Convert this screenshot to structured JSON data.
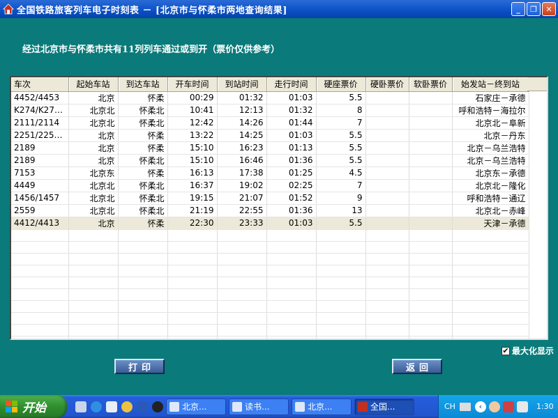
{
  "window": {
    "title": "全国铁路旅客列车电子时刻表 － [北京市与怀柔市两地查询结果]",
    "minimize": "_",
    "restore": "❐",
    "close": "✕"
  },
  "summary": "经过北京市与怀柔市共有11列列车通过或到开（票价仅供参考）",
  "table": {
    "headers": [
      "车次",
      "起始车站",
      "到达车站",
      "开车时间",
      "到站时间",
      "走行时间",
      "硬座票价",
      "硬卧票价",
      "软卧票价",
      "始发站－终到站"
    ],
    "rows": [
      [
        "4452/4453",
        "北京",
        "怀柔",
        "00:29",
        "01:32",
        "01:03",
        "5.5",
        "",
        "",
        "石家庄－承德"
      ],
      [
        "K274/K275...",
        "北京北",
        "怀柔北",
        "10:41",
        "12:13",
        "01:32",
        "8",
        "",
        "",
        "呼和浩特－海拉尔"
      ],
      [
        "2111/2114",
        "北京北",
        "怀柔北",
        "12:42",
        "14:26",
        "01:44",
        "7",
        "",
        "",
        "北京北－阜新"
      ],
      [
        "2251/2253/...",
        "北京",
        "怀柔",
        "13:22",
        "14:25",
        "01:03",
        "5.5",
        "",
        "",
        "北京－丹东"
      ],
      [
        "2189",
        "北京",
        "怀柔",
        "15:10",
        "16:23",
        "01:13",
        "5.5",
        "",
        "",
        "北京－乌兰浩特"
      ],
      [
        "2189",
        "北京",
        "怀柔北",
        "15:10",
        "16:46",
        "01:36",
        "5.5",
        "",
        "",
        "北京－乌兰浩特"
      ],
      [
        "7153",
        "北京东",
        "怀柔",
        "16:13",
        "17:38",
        "01:25",
        "4.5",
        "",
        "",
        "北京东－承德"
      ],
      [
        "4449",
        "北京北",
        "怀柔北",
        "16:37",
        "19:02",
        "02:25",
        "7",
        "",
        "",
        "北京北－隆化"
      ],
      [
        "1456/1457",
        "北京北",
        "怀柔北",
        "19:15",
        "21:07",
        "01:52",
        "9",
        "",
        "",
        "呼和浩特－通辽"
      ],
      [
        "2559",
        "北京北",
        "怀柔北",
        "21:19",
        "22:55",
        "01:36",
        "13",
        "",
        "",
        "北京北－赤峰"
      ],
      [
        "4412/4413",
        "北京",
        "怀柔",
        "22:30",
        "23:33",
        "01:03",
        "5.5",
        "",
        "",
        "天津－承德"
      ]
    ],
    "selected_row": 10,
    "empty_rows": 10
  },
  "max_display": {
    "label": "最大化显示",
    "checked": true
  },
  "buttons": {
    "print": "打印",
    "back": "返回"
  },
  "taskbar": {
    "start": "开始",
    "tasks": [
      "北京...",
      "读书...",
      "北京...",
      "全国..."
    ],
    "active_task": 3,
    "lang": "CH",
    "clock": "1:30"
  },
  "colors": {
    "client_bg": "#0a7a7a",
    "title_bar": "#0a4fc6",
    "selected_row": "#ede9d9",
    "button_bg": "#4a6ba5"
  }
}
